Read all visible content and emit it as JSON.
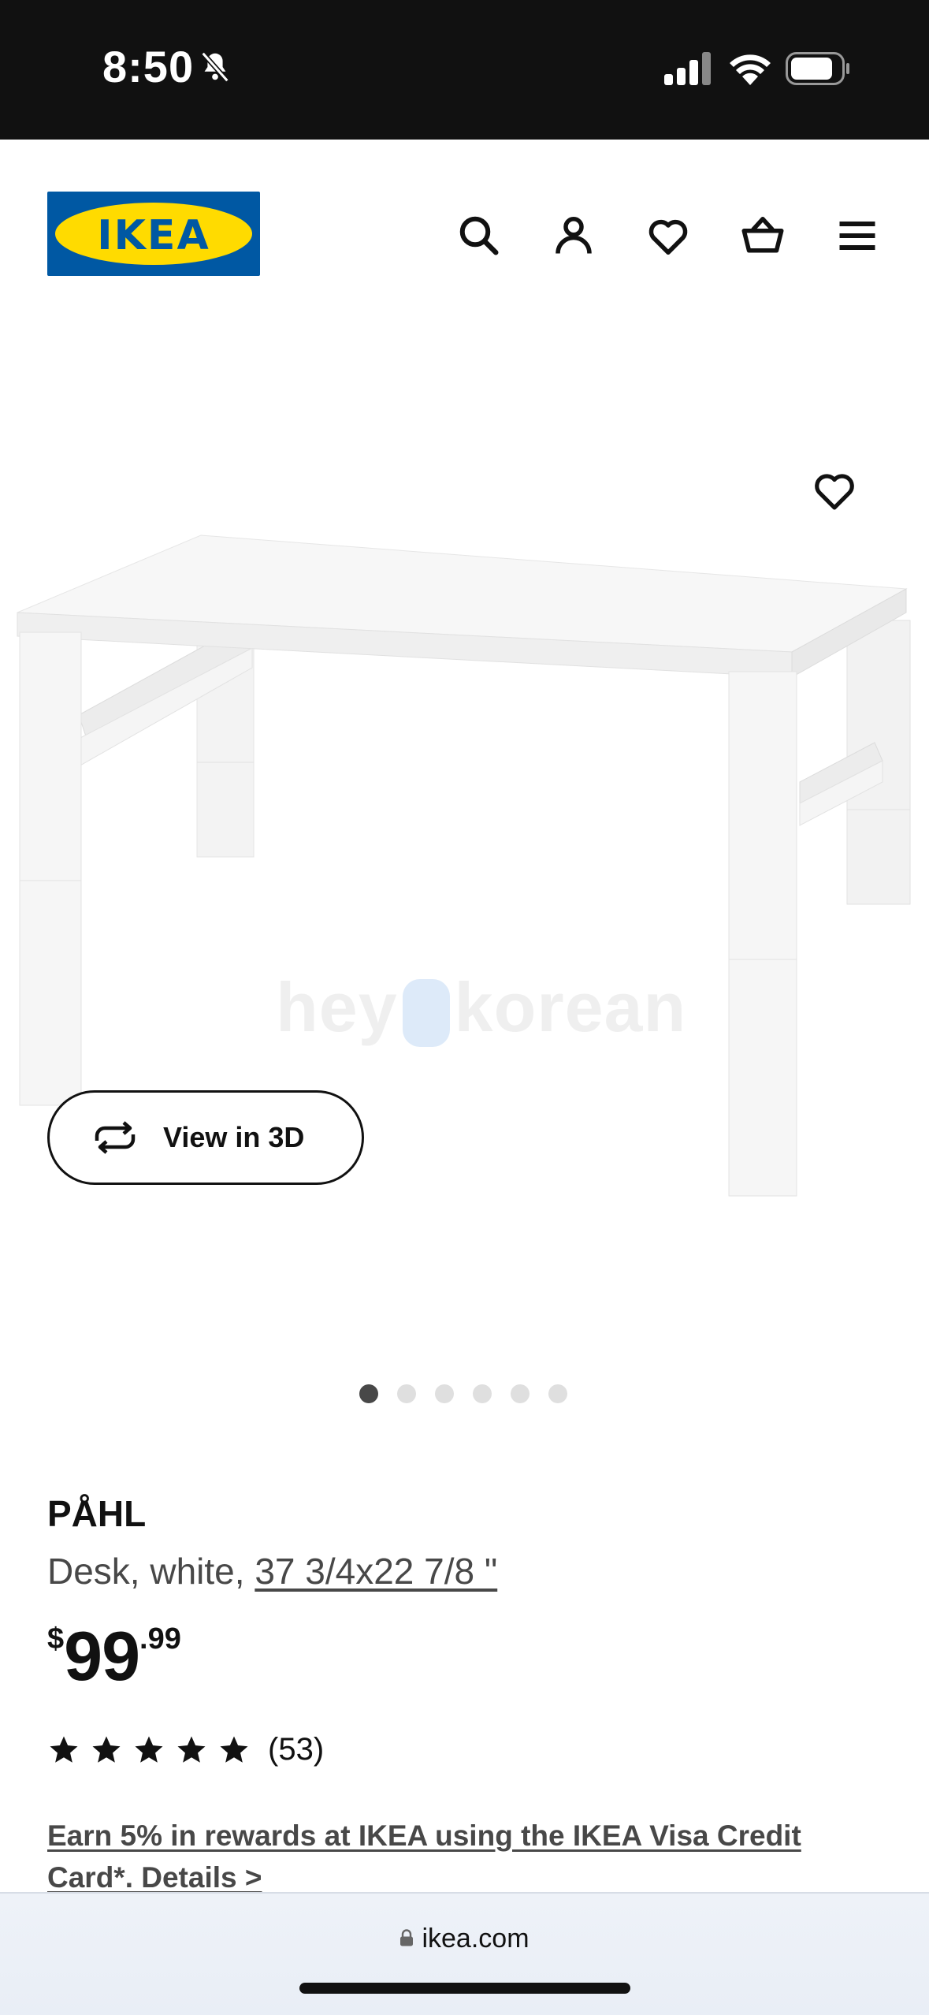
{
  "status_bar": {
    "time": "8:50",
    "icons": [
      "bell-slash-icon",
      "signal-icon",
      "wifi-icon",
      "battery-icon"
    ]
  },
  "header": {
    "logo_text": "IKEA",
    "icons": [
      "search-icon",
      "account-icon",
      "heart-icon",
      "cart-icon",
      "menu-icon"
    ]
  },
  "gallery": {
    "watermark": "hey korean",
    "view_3d_label": "View in 3D",
    "image_count": 6,
    "active_index": 0
  },
  "product": {
    "name": "PÅHL",
    "description": "Desk, white, ",
    "size": "37 3/4x22 7/8 \"",
    "price_currency": "$",
    "price_integer": "99",
    "price_decimal": ".99",
    "rating": 5,
    "review_count": "(53)",
    "promo": "Earn 5% in rewards at IKEA using the IKEA Visa Credit Card*. Details >"
  },
  "browser": {
    "url": "ikea.com"
  },
  "colors": {
    "brand_blue": "#0058a3",
    "brand_yellow": "#ffdb00",
    "text_dark": "#111111",
    "text_muted": "#484848"
  }
}
